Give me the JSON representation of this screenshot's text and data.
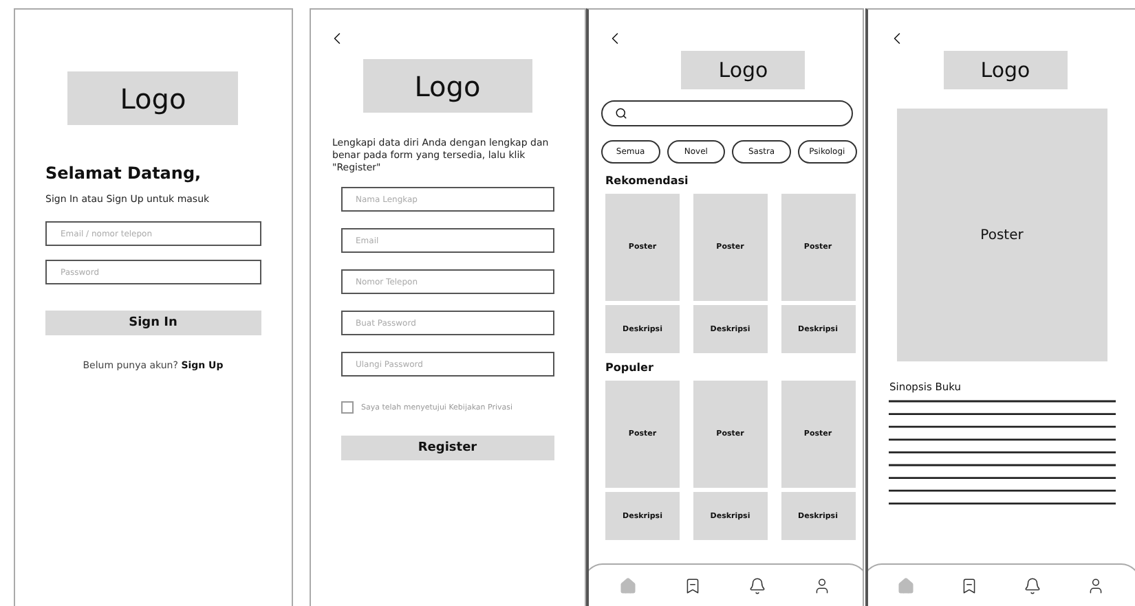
{
  "screens": [
    {
      "kind": "login",
      "logo": "Logo",
      "heading": "Selamat Datang,",
      "subheading": "Sign In atau Sign Up untuk masuk",
      "fields": [
        {
          "placeholder": "Email / nomor telepon"
        },
        {
          "placeholder": "Password"
        }
      ],
      "button": "Sign In",
      "footer": {
        "text": "Belum punya akun?",
        "link": "Sign Up"
      }
    },
    {
      "kind": "register",
      "logo": "Logo",
      "intro": "Lengkapi data diri Anda dengan lengkap dan benar pada form yang tersedia, lalu klik \"Register\"",
      "fields": [
        {
          "placeholder": "Nama Lengkap"
        },
        {
          "placeholder": "Email"
        },
        {
          "placeholder": "Nomor Telepon"
        },
        {
          "placeholder": "Buat Password"
        },
        {
          "placeholder": "Ulangi Password"
        }
      ],
      "agreement": {
        "label": "Saya telah menyetujui Kebijakan Privasi",
        "checked": false
      },
      "button": "Register"
    },
    {
      "kind": "catalog",
      "logo": "Logo",
      "chips": [
        "Semua",
        "Novel",
        "Sastra",
        "Psikologi"
      ],
      "sections": [
        {
          "title": "Rekomendasi",
          "books": [
            {
              "poster": "Poster",
              "description": "Deskripsi"
            },
            {
              "poster": "Poster",
              "description": "Deskripsi"
            },
            {
              "poster": "Poster",
              "description": "Deskripsi"
            }
          ]
        },
        {
          "title": "Populer",
          "books": [
            {
              "poster": "Poster",
              "description": "Deskripsi"
            },
            {
              "poster": "Poster",
              "description": "Deskripsi"
            },
            {
              "poster": "Poster",
              "description": "Deskripsi"
            }
          ]
        }
      ],
      "nav": [
        {
          "kind": "home",
          "selected": true
        },
        {
          "kind": "bookmark",
          "selected": false
        },
        {
          "kind": "bell",
          "selected": false
        },
        {
          "kind": "user",
          "selected": false
        }
      ]
    },
    {
      "kind": "detail",
      "logo": "Logo",
      "poster": "Poster",
      "synopsis_title": "Sinopsis Buku",
      "nav": [
        {
          "kind": "home",
          "selected": true
        },
        {
          "kind": "bookmark",
          "selected": false
        },
        {
          "kind": "bell",
          "selected": false
        },
        {
          "kind": "user",
          "selected": false
        }
      ]
    }
  ]
}
